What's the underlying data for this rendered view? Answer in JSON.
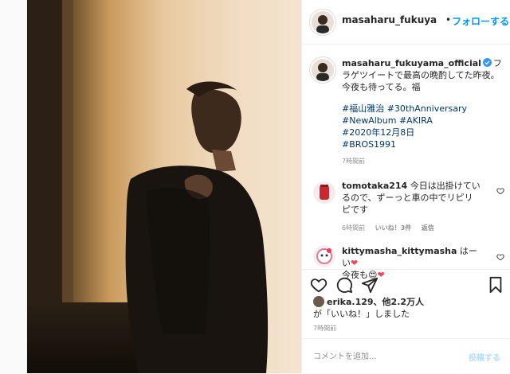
{
  "post": {
    "image_alt": "photo"
  },
  "header": {
    "username": "masaharu_fukuya",
    "dot": "•",
    "follow_label": "フォローする"
  },
  "caption": {
    "username": "masaharu_fukuyama_official",
    "text": "フラゲツイートで最高の晩酌してた昨夜。今夜も待ってる。福",
    "hashtags": [
      "#福山雅治 #30thAnniversary",
      "#NewAlbum #AKIRA",
      "#2020年12月8日",
      "#BROS1991"
    ],
    "time": "7時間前"
  },
  "comments": [
    {
      "username": "tomotaka214",
      "text": "今日は出掛けているので、ずーっと車の中でリピリピです",
      "time": "6時間前",
      "likes": "いいね！3件",
      "reply": "返信"
    },
    {
      "username": "kittymasha_kittymasha",
      "line1": "はーい",
      "line2": "今夜も"
    }
  ],
  "likes": {
    "user": "erika.129",
    "others": "、他2.2万人",
    "suffix": "が「いいね！」しました"
  },
  "posted_time": "7時間前",
  "comment_box": {
    "placeholder": "コメントを追加...",
    "post_label": "投稿する"
  },
  "icons": {
    "heart": "heart-icon",
    "comment": "comment-icon",
    "share": "share-icon",
    "save": "bookmark-icon",
    "verified": "verified-badge-icon"
  },
  "colors": {
    "link": "#0095f6",
    "hashtag": "#00376b",
    "muted": "#8e8e8e",
    "heart_red": "#ed4956"
  }
}
